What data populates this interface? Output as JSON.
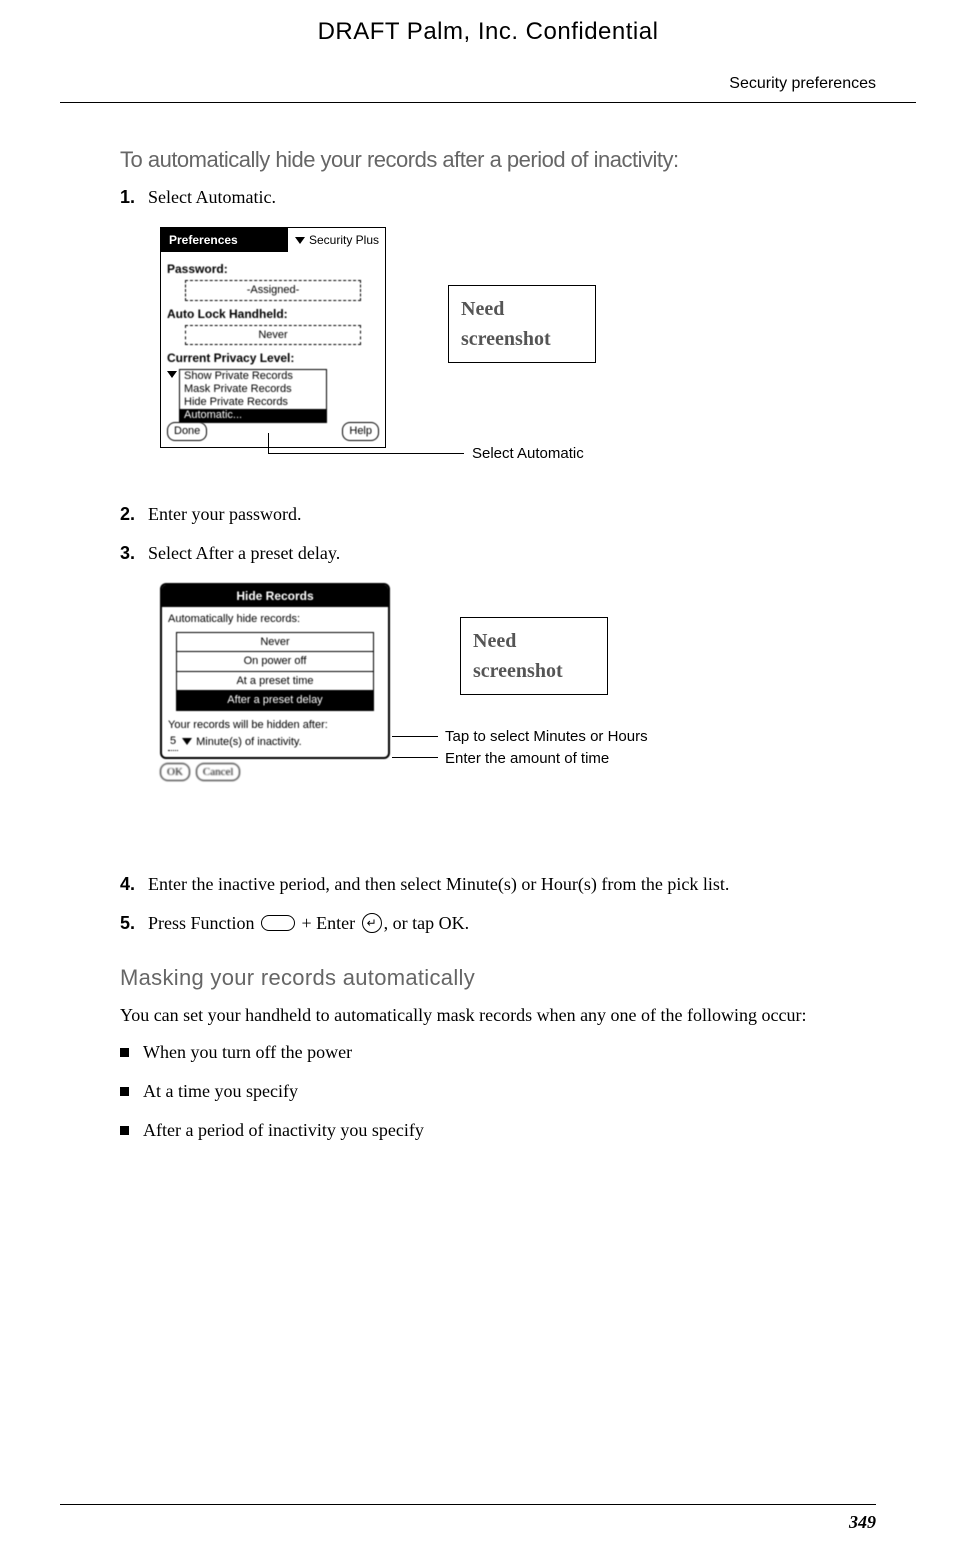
{
  "header": {
    "draft": "DRAFT   Palm, Inc. Confidential",
    "running": "Security preferences"
  },
  "section1": {
    "title": "To automatically hide your records after a period of inactivity:",
    "steps": [
      {
        "num": "1.",
        "text": "Select Automatic."
      },
      {
        "num": "2.",
        "text": "Enter your password."
      },
      {
        "num": "3.",
        "text": "Select After a preset delay."
      },
      {
        "num": "4.",
        "text": "Enter the inactive period, and then select Minute(s) or Hour(s) from the pick list."
      },
      {
        "num": "5.",
        "text_a": "Press Function ",
        "text_b": " + Enter ",
        "text_c": ", or tap OK."
      }
    ]
  },
  "fig1": {
    "prefs_title": "Preferences",
    "dropdown": "Security Plus",
    "password_label": "Password:",
    "password_val": "-Assigned-",
    "autolock_label": "Auto Lock Handheld:",
    "autolock_val": "Never",
    "priv_label": "Current Privacy Level:",
    "priv_items": [
      "Show Private Records",
      "Mask Private Records",
      "Hide Private Records",
      "Automatic..."
    ],
    "done": "Done",
    "help": "Help",
    "need": "Need screenshot",
    "callout": "Select Automatic"
  },
  "fig2": {
    "title": "Hide Records",
    "sub": "Automatically hide records:",
    "opts": [
      "Never",
      "On power off",
      "At a preset time",
      "After a preset delay"
    ],
    "after_label": "Your records will be hidden after:",
    "input_val": "5",
    "unit": "Minute(s) of inactivity.",
    "ok": "OK",
    "cancel": "Cancel",
    "need": "Need screenshot",
    "call_a": "Tap to select Minutes or Hours",
    "call_b": "Enter the amount of time"
  },
  "section2": {
    "title": "Masking your records automatically",
    "intro": "You can set your handheld to automatically mask records when any one of the following occur:",
    "bullets": [
      "When you turn off the power",
      "At a time you specify",
      "After a period of inactivity you specify"
    ]
  },
  "footer": {
    "page": "349"
  }
}
